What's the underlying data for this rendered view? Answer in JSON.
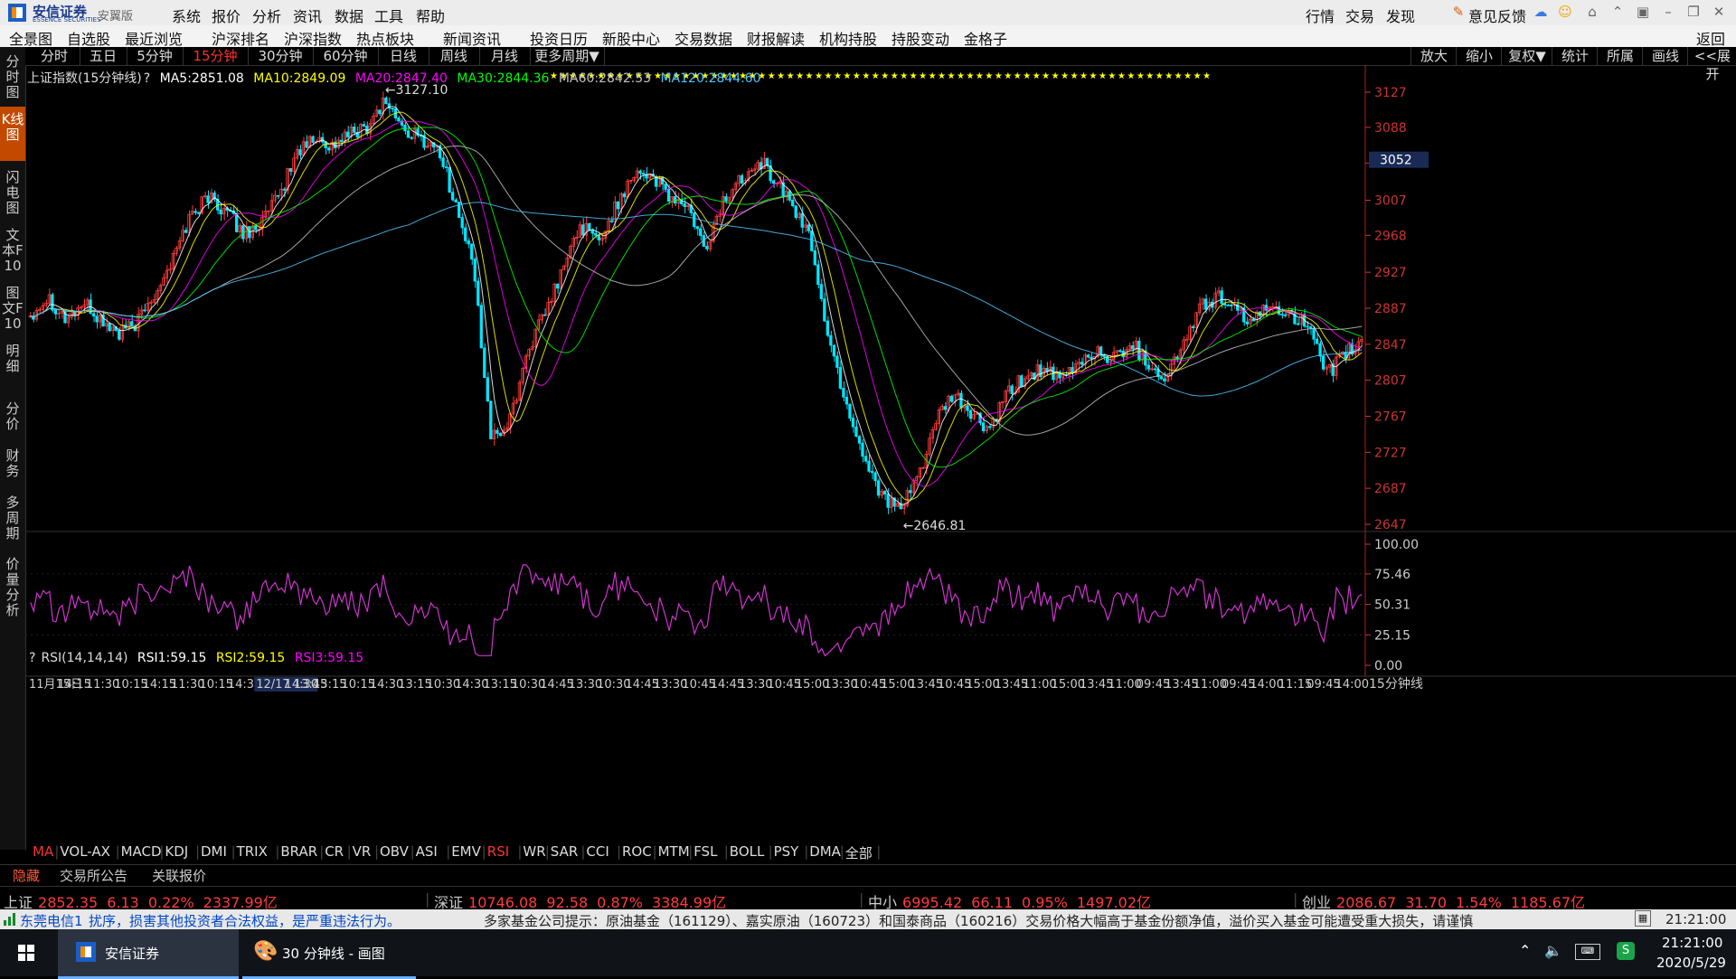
{
  "app": {
    "brand": "安信证券",
    "brand_en": "ESSENCE SECURITIES",
    "edition": "安翼版",
    "menu": [
      "系统",
      "报价",
      "分析",
      "资讯",
      "数据",
      "工具",
      "帮助"
    ],
    "right_menu": [
      "行情",
      "交易",
      "发现"
    ],
    "feedback": "意见反馈"
  },
  "nav": {
    "items": [
      "全景图",
      "自选股",
      "最近浏览",
      "沪深排名",
      "沪深指数",
      "热点板块",
      "新闻资讯",
      "投资日历",
      "新股中心",
      "交易数据",
      "财报解读",
      "机构持股",
      "持股变动",
      "金格子"
    ],
    "back": "返回"
  },
  "left_tabs": [
    {
      "label": "分时图",
      "active": false
    },
    {
      "label": "K线图",
      "active": true
    },
    {
      "label": "闪电图",
      "active": false
    },
    {
      "label": "文本F10",
      "active": false
    },
    {
      "label": "图文F10",
      "active": false
    },
    {
      "label": "明细",
      "active": false
    },
    {
      "label": "分价",
      "active": false
    },
    {
      "label": "财务",
      "active": false
    },
    {
      "label": "多周期",
      "active": false
    },
    {
      "label": "价量分析",
      "active": false
    }
  ],
  "periods": [
    {
      "label": "分时",
      "active": false
    },
    {
      "label": "五日",
      "active": false
    },
    {
      "label": "5分钟",
      "active": false
    },
    {
      "label": "15分钟",
      "active": true
    },
    {
      "label": "30分钟",
      "active": false
    },
    {
      "label": "60分钟",
      "active": false
    },
    {
      "label": "日线",
      "active": false
    },
    {
      "label": "周线",
      "active": false
    },
    {
      "label": "月线",
      "active": false
    },
    {
      "label": "更多周期▼",
      "active": false
    }
  ],
  "chart_tools": [
    "放大",
    "缩小",
    "复权▼",
    "统计",
    "所属",
    "画线",
    "<<展开"
  ],
  "ma": {
    "title": "上证指数(15分钟线)",
    "help": "?",
    "items": [
      {
        "label": "MA5:2851.08",
        "color": "#ffffff"
      },
      {
        "label": "MA10:2849.09",
        "color": "#ffff00"
      },
      {
        "label": "MA20:2847.40",
        "color": "#ff00ff"
      },
      {
        "label": "MA30:2844.36",
        "color": "#00ff00"
      },
      {
        "label": "MA60:2842.53",
        "color": "#c0c0c0"
      },
      {
        "label": "MA120:2844.60",
        "color": "#4ec6ff"
      }
    ]
  },
  "rsi": {
    "title": "RSI(14,14,14)",
    "help": "?",
    "items": [
      {
        "label": "RSI1:59.15",
        "color": "#ffffff"
      },
      {
        "label": "RSI2:59.15",
        "color": "#ffff00"
      },
      {
        "label": "RSI3:59.15",
        "color": "#ff00ff"
      }
    ]
  },
  "colors": {
    "up": "#ff3b3b",
    "down": "#00e5ff",
    "rsi": "#d033d0",
    "axis": "#cc3333"
  },
  "chart_data": {
    "type": "candlestick",
    "title": "上证指数(15分钟线)",
    "price_ticks": [
      3127,
      3088,
      3048,
      3007,
      2968,
      2927,
      2887,
      2847,
      2807,
      2767,
      2727,
      2687,
      2647
    ],
    "price_range": [
      2647,
      3127
    ],
    "current_price_label": "3052",
    "annotations": [
      {
        "label": "3127.10",
        "value": 3127.1
      },
      {
        "label": "2646.81",
        "value": 2646.81
      }
    ],
    "approx_path": [
      2880,
      2900,
      2875,
      2892,
      2873,
      2858,
      2870,
      2905,
      2940,
      2990,
      3012,
      2995,
      2970,
      2982,
      3010,
      3060,
      3075,
      3068,
      3080,
      3090,
      3120,
      3085,
      3075,
      3065,
      3000,
      2930,
      2740,
      2760,
      2840,
      2880,
      2930,
      2980,
      2960,
      3000,
      3040,
      3035,
      3010,
      3000,
      2950,
      3005,
      3030,
      3055,
      3028,
      3000,
      2960,
      2850,
      2780,
      2720,
      2680,
      2660,
      2700,
      2760,
      2790,
      2770,
      2750,
      2790,
      2810,
      2820,
      2805,
      2825,
      2840,
      2830,
      2850,
      2825,
      2810,
      2850,
      2890,
      2900,
      2880,
      2875,
      2890,
      2883,
      2865,
      2812,
      2835,
      2850
    ],
    "x_labels": [
      "11月15日",
      "14:15",
      "11:30",
      "10:15",
      "14:15",
      "11:30",
      "10:15",
      "14:3",
      "12/17 13:45",
      "14:30",
      "13:15",
      "10:15",
      "14:30",
      "13:15",
      "10:30",
      "14:30",
      "13:15",
      "10:30",
      "14:45",
      "13:30",
      "10:30",
      "14:45",
      "13:30",
      "10:45",
      "14:45",
      "13:30",
      "10:45",
      "15:00",
      "13:30",
      "10:45",
      "15:00",
      "13:45",
      "10:45",
      "15:00",
      "13:45",
      "11:00",
      "15:00",
      "13:45",
      "11:00",
      "09:45",
      "13:45",
      "11:00",
      "09:45",
      "14:00",
      "11:15",
      "09:45",
      "14:00"
    ],
    "x_axis_end_label": "15分钟线",
    "rsi_ticks": [
      "100.00",
      "75.46",
      "50.31",
      "25.15",
      "0.00"
    ]
  },
  "indicators": [
    {
      "label": "MA",
      "active": true
    },
    {
      "label": "VOL-AX",
      "active": false
    },
    {
      "label": "MACD",
      "active": false
    },
    {
      "label": "KDJ",
      "active": false
    },
    {
      "label": "DMI",
      "active": false
    },
    {
      "label": "TRIX",
      "active": false
    },
    {
      "label": "BRAR",
      "active": false
    },
    {
      "label": "CR",
      "active": false
    },
    {
      "label": "VR",
      "active": false
    },
    {
      "label": "OBV",
      "active": false
    },
    {
      "label": "ASI",
      "active": false
    },
    {
      "label": "EMV",
      "active": false
    },
    {
      "label": "RSI",
      "active": true
    },
    {
      "label": "WR",
      "active": false
    },
    {
      "label": "SAR",
      "active": false
    },
    {
      "label": "CCI",
      "active": false
    },
    {
      "label": "ROC",
      "active": false
    },
    {
      "label": "MTM",
      "active": false
    },
    {
      "label": "FSL",
      "active": false
    },
    {
      "label": "BOLL",
      "active": false
    },
    {
      "label": "PSY",
      "active": false
    },
    {
      "label": "DMA",
      "active": false
    },
    {
      "label": "全部",
      "active": false
    }
  ],
  "announce_tabs": [
    "隐藏",
    "交易所公告",
    "关联报价"
  ],
  "indexes": [
    {
      "name": "上证",
      "price": "2852.35",
      "change": "6.13",
      "pct": "0.22%",
      "amount": "2337.99亿"
    },
    {
      "name": "深证",
      "price": "10746.08",
      "change": "92.58",
      "pct": "0.87%",
      "amount": "3384.99亿"
    },
    {
      "name": "中小",
      "price": "6995.42",
      "change": "66.11",
      "pct": "0.95%",
      "amount": "1497.02亿"
    },
    {
      "name": "创业",
      "price": "2086.67",
      "change": "31.70",
      "pct": "1.54%",
      "amount": "1185.67亿"
    }
  ],
  "status": {
    "server": "东莞电信1",
    "ticker": "扰序，损害其他投资者合法权益，是严重违法行为。",
    "notice": "多家基金公司提示：原油基金（161129）、嘉实原油（160723）和国泰商品（160216）交易价格大幅高于基金份额净值，溢价买入基金可能遭受重大损失，请谨慎",
    "time": "21:21:00"
  },
  "taskbar": {
    "tasks": [
      "安信证券",
      "30 分钟线 - 画图"
    ],
    "clock_time": "21:21:00",
    "clock_date": "2020/5/29"
  }
}
